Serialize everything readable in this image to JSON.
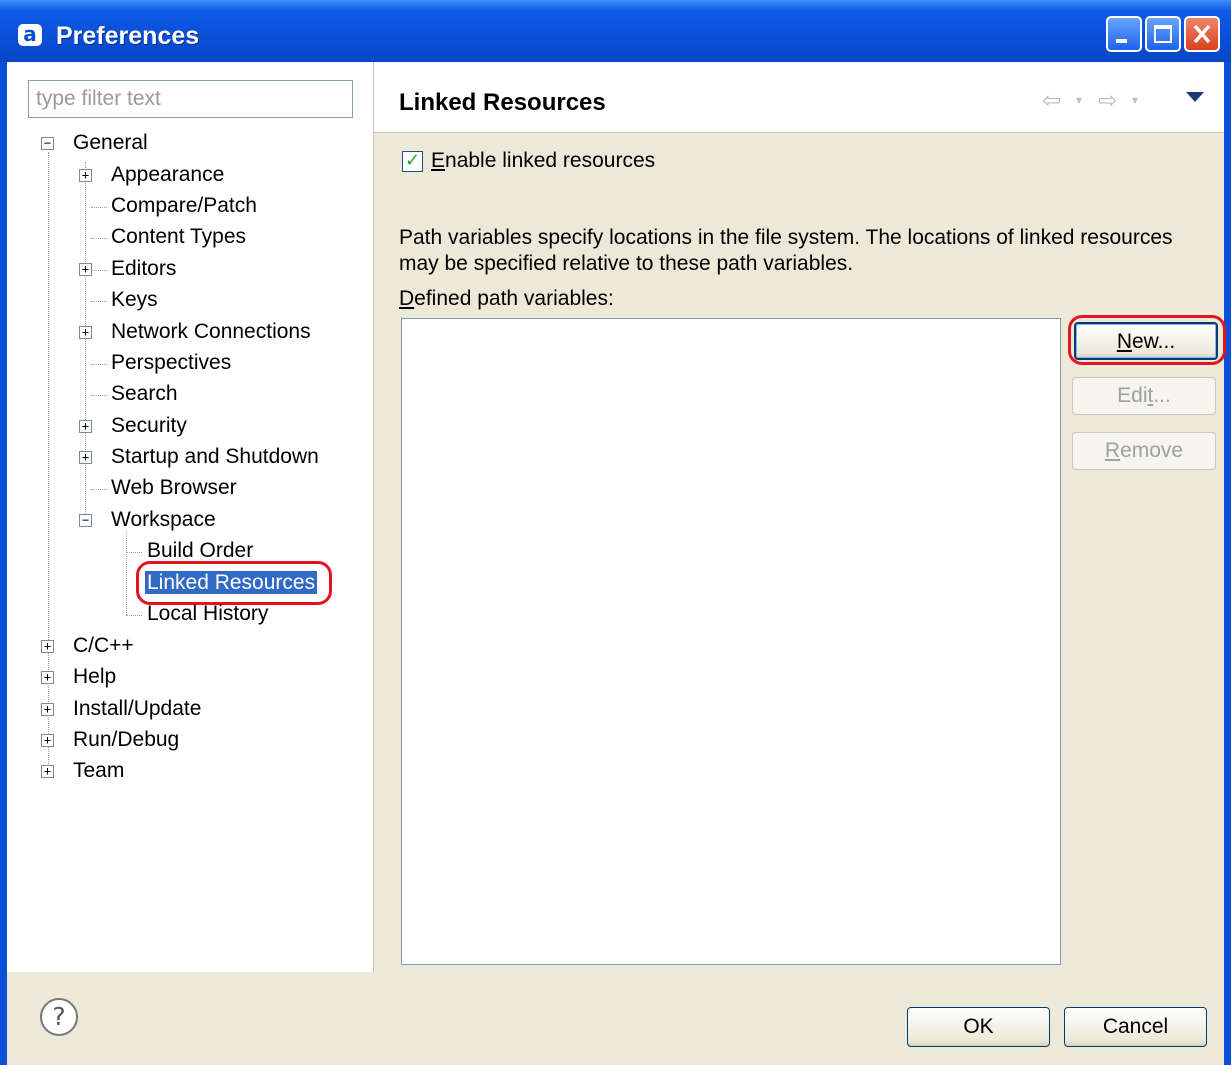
{
  "window": {
    "title": "Preferences",
    "app_icon_glyph": "a",
    "controls": [
      "minimize-icon",
      "maximize-icon",
      "close-icon"
    ]
  },
  "filter": {
    "placeholder": "type filter text",
    "value": ""
  },
  "tree": {
    "general": "General",
    "appearance": "Appearance",
    "compare_patch": "Compare/Patch",
    "content_types": "Content Types",
    "editors": "Editors",
    "keys": "Keys",
    "network_connections": "Network Connections",
    "perspectives": "Perspectives",
    "search": "Search",
    "security": "Security",
    "startup_shutdown": "Startup and Shutdown",
    "web_browser": "Web Browser",
    "workspace": "Workspace",
    "build_order": "Build Order",
    "linked_resources": "Linked Resources",
    "local_history": "Local History",
    "cpp": "C/C++",
    "help": "Help",
    "install_update": "Install/Update",
    "run_debug": "Run/Debug",
    "team": "Team",
    "selected": "Linked Resources"
  },
  "page": {
    "title": "Linked Resources",
    "enable_checkbox": {
      "checked": true,
      "label_mnemonic": "E",
      "label_rest": "nable linked resources"
    },
    "description_line1": "Path variables specify locations in the file system. The locations of linked resources",
    "description_line2": "may be specified relative to these path variables.",
    "defined_label_mnemonic": "D",
    "defined_label_rest": "efined path variables:",
    "path_variables": [],
    "buttons": {
      "new_mnemonic": "N",
      "new_rest": "ew...",
      "edit_before": "Edi",
      "edit_mnemonic": "t",
      "edit_after": "...",
      "remove_mnemonic": "R",
      "remove_rest": "emove"
    }
  },
  "footer": {
    "help_glyph": "?",
    "ok_label": "OK",
    "cancel_label": "Cancel"
  },
  "colors": {
    "titlebar": "#0a4fd8",
    "selection": "#316ac5",
    "highlight_circle": "#e3141f",
    "dialog_background": "#ece9d8"
  }
}
